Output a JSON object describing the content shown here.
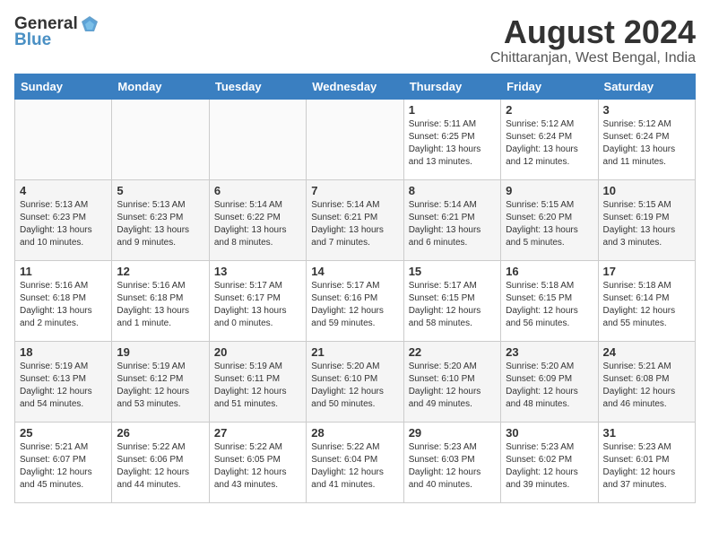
{
  "logo": {
    "general": "General",
    "blue": "Blue"
  },
  "title": "August 2024",
  "subtitle": "Chittaranjan, West Bengal, India",
  "days_of_week": [
    "Sunday",
    "Monday",
    "Tuesday",
    "Wednesday",
    "Thursday",
    "Friday",
    "Saturday"
  ],
  "weeks": [
    [
      {
        "day": "",
        "empty": true
      },
      {
        "day": "",
        "empty": true
      },
      {
        "day": "",
        "empty": true
      },
      {
        "day": "",
        "empty": true
      },
      {
        "day": "1",
        "sunrise": "5:11 AM",
        "sunset": "6:25 PM",
        "daylight": "13 hours and 13 minutes."
      },
      {
        "day": "2",
        "sunrise": "5:12 AM",
        "sunset": "6:24 PM",
        "daylight": "13 hours and 12 minutes."
      },
      {
        "day": "3",
        "sunrise": "5:12 AM",
        "sunset": "6:24 PM",
        "daylight": "13 hours and 11 minutes."
      }
    ],
    [
      {
        "day": "4",
        "sunrise": "5:13 AM",
        "sunset": "6:23 PM",
        "daylight": "13 hours and 10 minutes."
      },
      {
        "day": "5",
        "sunrise": "5:13 AM",
        "sunset": "6:23 PM",
        "daylight": "13 hours and 9 minutes."
      },
      {
        "day": "6",
        "sunrise": "5:14 AM",
        "sunset": "6:22 PM",
        "daylight": "13 hours and 8 minutes."
      },
      {
        "day": "7",
        "sunrise": "5:14 AM",
        "sunset": "6:21 PM",
        "daylight": "13 hours and 7 minutes."
      },
      {
        "day": "8",
        "sunrise": "5:14 AM",
        "sunset": "6:21 PM",
        "daylight": "13 hours and 6 minutes."
      },
      {
        "day": "9",
        "sunrise": "5:15 AM",
        "sunset": "6:20 PM",
        "daylight": "13 hours and 5 minutes."
      },
      {
        "day": "10",
        "sunrise": "5:15 AM",
        "sunset": "6:19 PM",
        "daylight": "13 hours and 3 minutes."
      }
    ],
    [
      {
        "day": "11",
        "sunrise": "5:16 AM",
        "sunset": "6:18 PM",
        "daylight": "13 hours and 2 minutes."
      },
      {
        "day": "12",
        "sunrise": "5:16 AM",
        "sunset": "6:18 PM",
        "daylight": "13 hours and 1 minute."
      },
      {
        "day": "13",
        "sunrise": "5:17 AM",
        "sunset": "6:17 PM",
        "daylight": "13 hours and 0 minutes."
      },
      {
        "day": "14",
        "sunrise": "5:17 AM",
        "sunset": "6:16 PM",
        "daylight": "12 hours and 59 minutes."
      },
      {
        "day": "15",
        "sunrise": "5:17 AM",
        "sunset": "6:15 PM",
        "daylight": "12 hours and 58 minutes."
      },
      {
        "day": "16",
        "sunrise": "5:18 AM",
        "sunset": "6:15 PM",
        "daylight": "12 hours and 56 minutes."
      },
      {
        "day": "17",
        "sunrise": "5:18 AM",
        "sunset": "6:14 PM",
        "daylight": "12 hours and 55 minutes."
      }
    ],
    [
      {
        "day": "18",
        "sunrise": "5:19 AM",
        "sunset": "6:13 PM",
        "daylight": "12 hours and 54 minutes."
      },
      {
        "day": "19",
        "sunrise": "5:19 AM",
        "sunset": "6:12 PM",
        "daylight": "12 hours and 53 minutes."
      },
      {
        "day": "20",
        "sunrise": "5:19 AM",
        "sunset": "6:11 PM",
        "daylight": "12 hours and 51 minutes."
      },
      {
        "day": "21",
        "sunrise": "5:20 AM",
        "sunset": "6:10 PM",
        "daylight": "12 hours and 50 minutes."
      },
      {
        "day": "22",
        "sunrise": "5:20 AM",
        "sunset": "6:10 PM",
        "daylight": "12 hours and 49 minutes."
      },
      {
        "day": "23",
        "sunrise": "5:20 AM",
        "sunset": "6:09 PM",
        "daylight": "12 hours and 48 minutes."
      },
      {
        "day": "24",
        "sunrise": "5:21 AM",
        "sunset": "6:08 PM",
        "daylight": "12 hours and 46 minutes."
      }
    ],
    [
      {
        "day": "25",
        "sunrise": "5:21 AM",
        "sunset": "6:07 PM",
        "daylight": "12 hours and 45 minutes."
      },
      {
        "day": "26",
        "sunrise": "5:22 AM",
        "sunset": "6:06 PM",
        "daylight": "12 hours and 44 minutes."
      },
      {
        "day": "27",
        "sunrise": "5:22 AM",
        "sunset": "6:05 PM",
        "daylight": "12 hours and 43 minutes."
      },
      {
        "day": "28",
        "sunrise": "5:22 AM",
        "sunset": "6:04 PM",
        "daylight": "12 hours and 41 minutes."
      },
      {
        "day": "29",
        "sunrise": "5:23 AM",
        "sunset": "6:03 PM",
        "daylight": "12 hours and 40 minutes."
      },
      {
        "day": "30",
        "sunrise": "5:23 AM",
        "sunset": "6:02 PM",
        "daylight": "12 hours and 39 minutes."
      },
      {
        "day": "31",
        "sunrise": "5:23 AM",
        "sunset": "6:01 PM",
        "daylight": "12 hours and 37 minutes."
      }
    ]
  ],
  "labels": {
    "sunrise_prefix": "Sunrise: ",
    "sunset_prefix": "Sunset: ",
    "daylight_prefix": "Daylight: "
  }
}
